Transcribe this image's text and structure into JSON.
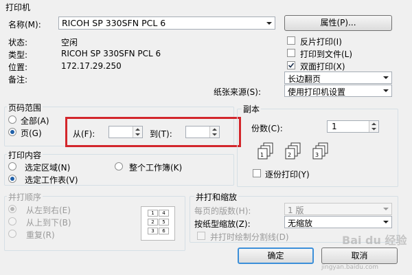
{
  "printer_group": {
    "legend": "打印机",
    "name_label": "名称(M):",
    "name_value": "RICOH SP 330SFN PCL 6",
    "properties_button": "属性(P)...",
    "status_label": "状态:",
    "status_value": "空闲",
    "type_label": "类型:",
    "type_value": "RICOH SP 330SFN PCL 6",
    "location_label": "位置:",
    "location_value": "172.17.29.250",
    "comment_label": "备注:",
    "reverse_print": {
      "label": "反片打印(I)",
      "checked": false
    },
    "print_to_file": {
      "label": "打印到文件(L)",
      "checked": false
    },
    "duplex": {
      "label": "双面打印(X)",
      "checked": true
    },
    "flip_value": "长边翻页",
    "paper_source_label": "纸张来源(S):",
    "paper_source_value": "使用打印机设置"
  },
  "page_range": {
    "legend": "页码范围",
    "all_label": "全部(A)",
    "pages_label": "页(G)",
    "from_label": "从(F):",
    "to_label": "到(T):",
    "from_value": "",
    "to_value": ""
  },
  "print_what": {
    "legend": "打印内容",
    "selection_label": "选定区域(N)",
    "workbook_label": "整个工作簿(K)",
    "sheets_label": "选定工作表(V)"
  },
  "copies": {
    "legend": "副本",
    "count_label": "份数(C):",
    "count_value": "1",
    "collate_label": "逐份打印(Y)",
    "collate_checked": false
  },
  "print_order": {
    "legend": "并打顺序",
    "left_to_right": "从左到右(E)",
    "top_to_bottom": "从上到下(B)",
    "repeat": "重复(R)",
    "preview_numbers": [
      "1",
      "2",
      "3",
      "4",
      "5",
      "6"
    ]
  },
  "zoom": {
    "legend": "并打和缩放",
    "pages_per_sheet_label": "每页的版数(H):",
    "pages_per_sheet_value": "1 版",
    "scale_label": "按纸型缩放(Z):",
    "scale_value": "无缩放",
    "draw_borders_label": "并打时绘制分割线(D)"
  },
  "buttons": {
    "ok": "确定",
    "cancel": "取消"
  },
  "watermark": "Bai du 经验",
  "watermark_url": "jingyan.baidu.com",
  "colors": {
    "highlight_box": "#d3262b",
    "radio_dot": "#1f5fa8",
    "group_border": "#d5dfe5"
  }
}
